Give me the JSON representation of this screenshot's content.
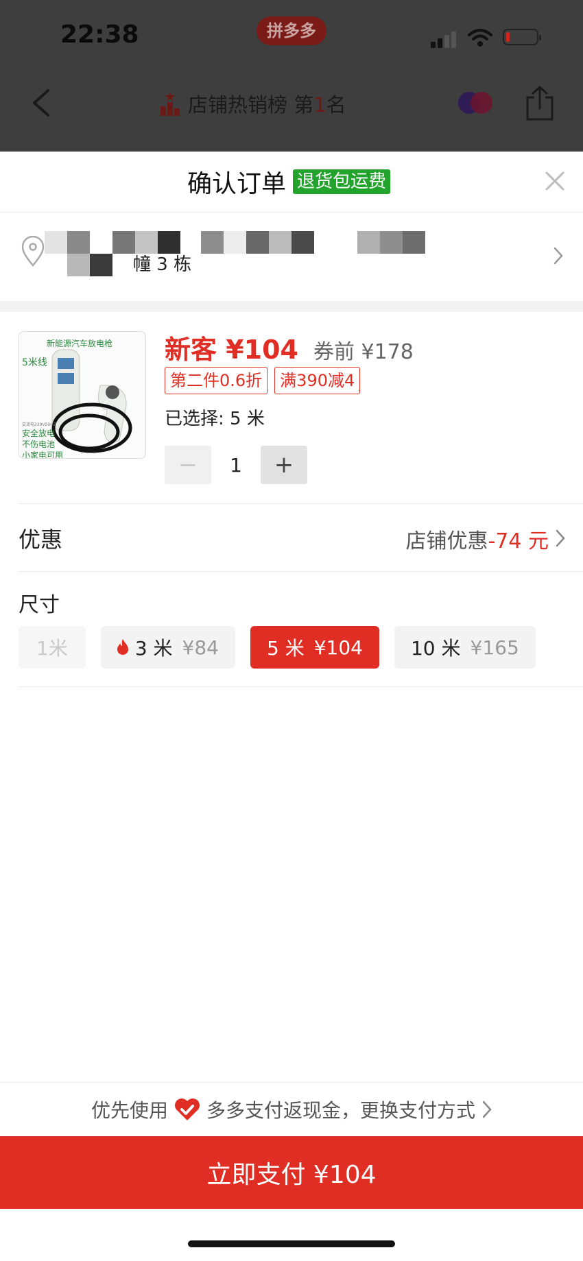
{
  "status_bar": {
    "time": "22:38",
    "app_badge": "拼多多"
  },
  "nav": {
    "title_prefix": "店铺热销榜 第",
    "rank": "1",
    "title_suffix": "名"
  },
  "sheet": {
    "title": "确认订单",
    "return_tag": "退货包运费"
  },
  "address": {
    "line_fragment": "幢 3 栋"
  },
  "product": {
    "thumb_title": "新能源汽车放电枪",
    "thumb_length": "5米线",
    "thumb_spec": "交流电220V50HZ",
    "thumb_features": [
      "安全放电",
      "不伤电池",
      "小家电可用"
    ],
    "price_new": "新客 ¥104",
    "price_before": "券前 ¥178",
    "promo_tags": [
      "第二件0.6折",
      "满390减4"
    ],
    "selected": "已选择: 5 米",
    "quantity": "1",
    "minus_label": "−",
    "plus_label": "+"
  },
  "discount": {
    "label": "优惠",
    "value_prefix": "店铺优惠",
    "value_amount": "-74 元"
  },
  "size": {
    "label": "尺寸",
    "options": [
      {
        "name": "1米",
        "price": "",
        "state": "disabled"
      },
      {
        "name": "3 米",
        "price": "¥84",
        "state": "hot"
      },
      {
        "name": "5 米",
        "price": "¥104",
        "state": "selected"
      },
      {
        "name": "10 米",
        "price": "¥165",
        "state": "normal"
      }
    ]
  },
  "pay_hint": {
    "prefix": "优先使用",
    "suffix": "多多支付返现金，更换支付方式"
  },
  "pay_button": "立即支付 ¥104",
  "colors": {
    "brand_red": "#e02e24",
    "tag_green": "#21a32c",
    "overlay": "#3e3e3e"
  }
}
